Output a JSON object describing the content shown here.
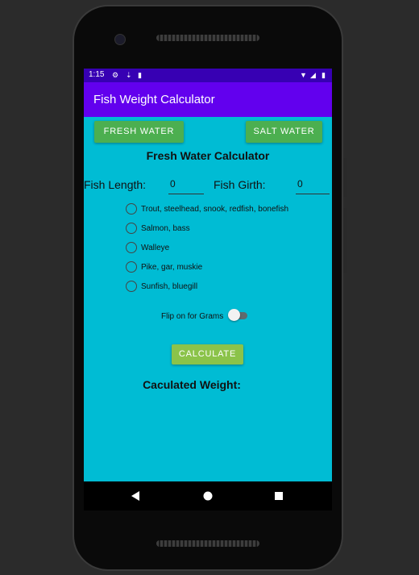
{
  "status_bar": {
    "time": "1:15"
  },
  "app_bar": {
    "title": "Fish Weight Calculator"
  },
  "buttons": {
    "fresh_water": "FRESH WATER",
    "salt_water": "SALT WATER",
    "calculate": "CALCULATE"
  },
  "calculator_title": "Fresh Water Calculator",
  "inputs": {
    "length_label": "Fish Length:",
    "length_value": "0",
    "girth_label": "Fish Girth:",
    "girth_value": "0"
  },
  "species_options": [
    "Trout, steelhead, snook, redfish, bonefish",
    "Salmon, bass",
    "Walleye",
    "Pike, gar, muskie",
    "Sunfish, bluegill"
  ],
  "grams_switch": {
    "label": "Flip on for Grams",
    "on": false
  },
  "result_label": "Caculated Weight:",
  "colors": {
    "status_bar": "#3700b3",
    "app_bar": "#6200ee",
    "background": "#00bcd4",
    "button": "#4caf50",
    "calculate_button": "#8bc34a"
  }
}
